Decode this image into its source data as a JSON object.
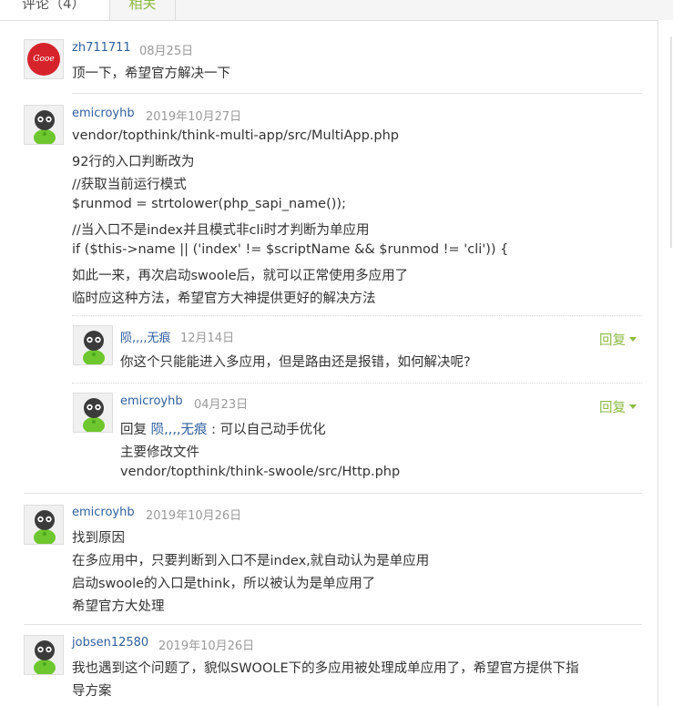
{
  "tabs": {
    "comments": "评论（4）",
    "related": "相关"
  },
  "reply_label": "回复",
  "comments": [
    {
      "author": "zh711711",
      "avatar_text": "Gooe",
      "date": "08月25日",
      "lines": [
        "顶一下，希望官方解决一下"
      ]
    },
    {
      "author": "emicroyhb",
      "date": "2019年10月27日",
      "lines": [
        "vendor/topthink/think-multi-app/src/MultiApp.php",
        "92行的入口判断改为",
        "//获取当前运行模式",
        "$runmod = strtolower(php_sapi_name());",
        "//当入口不是index并且模式非cli时才判断为单应用",
        "if ($this->name || ('index' != $scriptName && $runmod != 'cli')) {",
        "如此一来，再次启动swoole后，就可以正常使用多应用了",
        "临时应这种方法，希望官方大神提供更好的解决方法"
      ],
      "replies": [
        {
          "author": "陨,,,,无痕",
          "date": "12月14日",
          "lines": [
            "你这个只能能进入多应用，但是路由还是报错，如何解决呢?"
          ]
        },
        {
          "author": "emicroyhb",
          "date": "04月23日",
          "reply_prefix": "回复",
          "mention": "陨,,,,无痕",
          "mention_suffix": " : 可以自己动手优化",
          "lines": [
            "主要修改文件",
            "vendor/topthink/think-swoole/src/Http.php"
          ]
        }
      ]
    },
    {
      "author": "emicroyhb",
      "date": "2019年10月26日",
      "lines": [
        "找到原因",
        "在多应用中，只要判断到入口不是index,就自动认为是单应用",
        "启动swoole的入口是think，所以被认为是单应用了",
        "希望官方大处理"
      ]
    },
    {
      "author": "jobsen12580",
      "date": "2019年10月26日",
      "lines": [
        "我也遇到这个问题了，貌似SWOOLE下的多应用被处理成单应用了，希望官方提供下指",
        "导方案"
      ]
    }
  ]
}
